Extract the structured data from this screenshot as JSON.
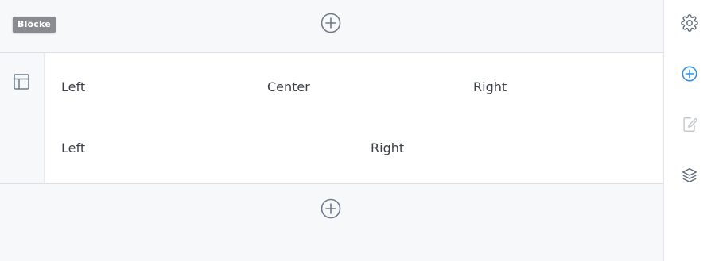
{
  "toolbar": {
    "blocks_tag": "Blöcke"
  },
  "block": {
    "rows": [
      {
        "cells": [
          "Left",
          "Center",
          "Right"
        ]
      },
      {
        "cells": [
          "Left",
          "Right"
        ]
      }
    ]
  },
  "icons": {
    "add_top": "plus-circle-icon",
    "add_bottom": "plus-circle-icon",
    "layout": "layout-icon",
    "sidebar": [
      "gear-icon",
      "plus-circle-icon",
      "edit-icon",
      "layers-icon"
    ]
  },
  "colors": {
    "icon_gray": "#6f7a88",
    "active_blue": "#2d8fe6",
    "disabled": "#c4c8cd",
    "tag_bg": "#888b90"
  }
}
